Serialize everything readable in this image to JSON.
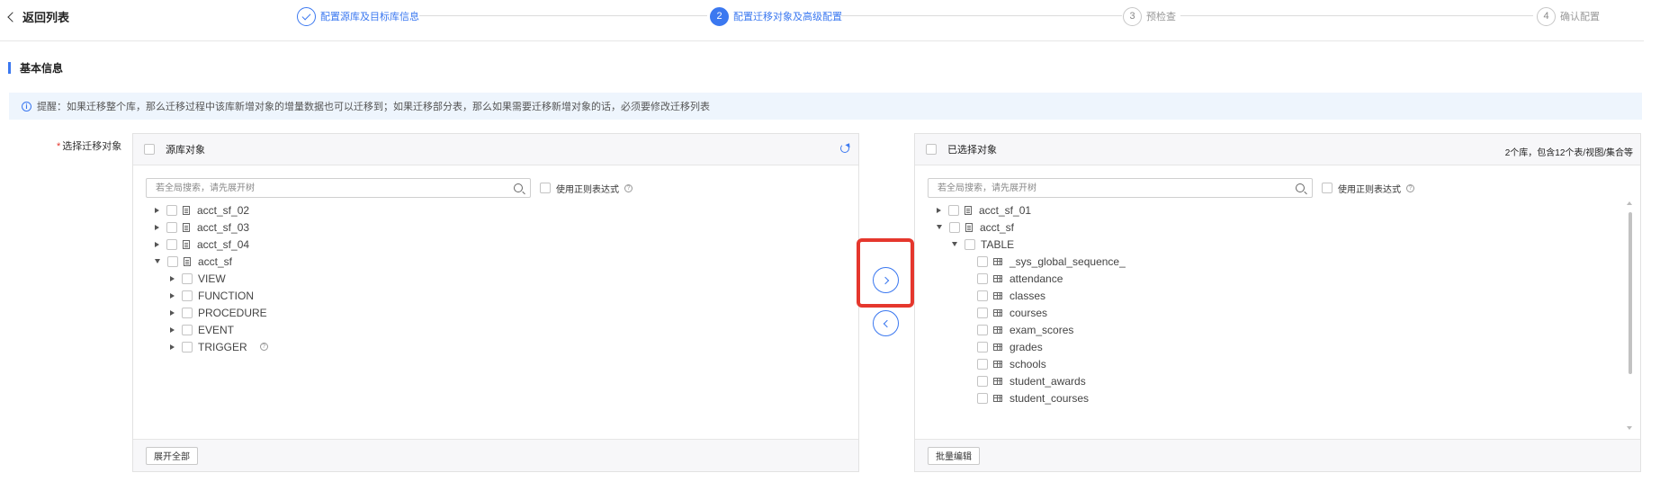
{
  "header": {
    "back_label": "返回列表",
    "steps": [
      {
        "num": "1",
        "label": "配置源库及目标库信息",
        "state": "done"
      },
      {
        "num": "2",
        "label": "配置迁移对象及高级配置",
        "state": "active"
      },
      {
        "num": "3",
        "label": "预检查",
        "state": "pending"
      },
      {
        "num": "4",
        "label": "确认配置",
        "state": "pending"
      }
    ]
  },
  "section": {
    "title": "基本信息"
  },
  "notice": {
    "text": "提醒：如果迁移整个库，那么迁移过程中该库新增对象的增量数据也可以迁移到；如果迁移部分表，那么如果需要迁移新增对象的话，必须要修改迁移列表"
  },
  "field": {
    "label": "选择迁移对象"
  },
  "source_panel": {
    "title": "源库对象",
    "search_placeholder": "若全局搜索，请先展开树",
    "regex_label": "使用正则表达式",
    "items": [
      {
        "label": "acct_sf_02"
      },
      {
        "label": "acct_sf_03"
      },
      {
        "label": "acct_sf_04"
      },
      {
        "label": "acct_sf"
      },
      {
        "label": "VIEW"
      },
      {
        "label": "FUNCTION"
      },
      {
        "label": "PROCEDURE"
      },
      {
        "label": "EVENT"
      },
      {
        "label": "TRIGGER"
      }
    ],
    "footer_button": "展开全部"
  },
  "target_panel": {
    "title": "已选择对象",
    "summary": "2个库，包含12个表/视图/集合等",
    "search_placeholder": "若全局搜索，请先展开树",
    "regex_label": "使用正则表达式",
    "items": [
      {
        "label": "acct_sf_01"
      },
      {
        "label": "acct_sf"
      },
      {
        "label": "TABLE"
      },
      {
        "label": "_sys_global_sequence_"
      },
      {
        "label": "attendance"
      },
      {
        "label": "classes"
      },
      {
        "label": "courses"
      },
      {
        "label": "exam_scores"
      },
      {
        "label": "grades"
      },
      {
        "label": "schools"
      },
      {
        "label": "student_awards"
      },
      {
        "label": "student_courses"
      }
    ],
    "footer_button": "批量编辑"
  },
  "colors": {
    "accent": "#3b78f0",
    "highlight": "#e5372d"
  }
}
